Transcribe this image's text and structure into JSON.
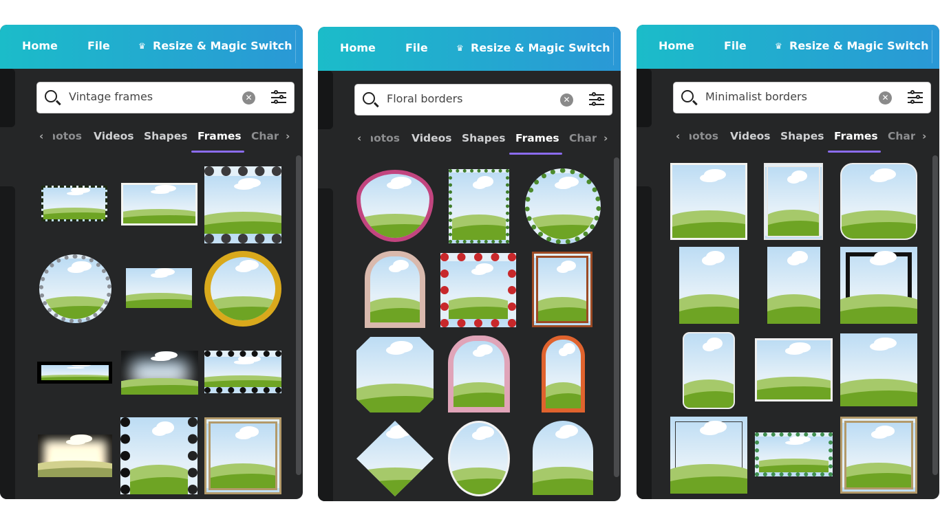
{
  "header": {
    "home": "Home",
    "file": "File",
    "resize": "Resize & Magic Switch",
    "resize_icon": "crown-icon"
  },
  "tabs": [
    "Photos",
    "Videos",
    "Shapes",
    "Frames",
    "Charts"
  ],
  "active_tab": "Frames",
  "colors": {
    "header_start": "#1bbcc9",
    "header_end": "#2a98d6",
    "panel_bg": "#252627",
    "tab_underline": "#8b6cf0"
  },
  "panels": [
    {
      "search_value": "Vintage frames",
      "frames": [
        "torn-edge",
        "white-border",
        "film-strip",
        "floral-circle",
        "plain",
        "gold-ornate-oval",
        "split-double",
        "vignette-white",
        "film-strip-wide",
        "vignette-sepia",
        "film-strip-vertical",
        "ornate-square"
      ]
    },
    {
      "search_value": "Floral borders",
      "frames": [
        "ribbon-heart",
        "leafy-rectangle",
        "wreath-circle",
        "lace-arch",
        "rose-square",
        "ornate-brown",
        "octagon",
        "pink-arch",
        "orange-arch",
        "floral-diamond",
        "oval",
        "arch-top"
      ]
    },
    {
      "search_value": "Minimalist borders",
      "frames": [
        "white-border",
        "double-line",
        "rounded",
        "plain",
        "plain",
        "black-inner-border",
        "rounded-portrait",
        "white-border-landscape",
        "plain-landscape",
        "thin-line",
        "dotted",
        "ornate-square"
      ]
    }
  ]
}
